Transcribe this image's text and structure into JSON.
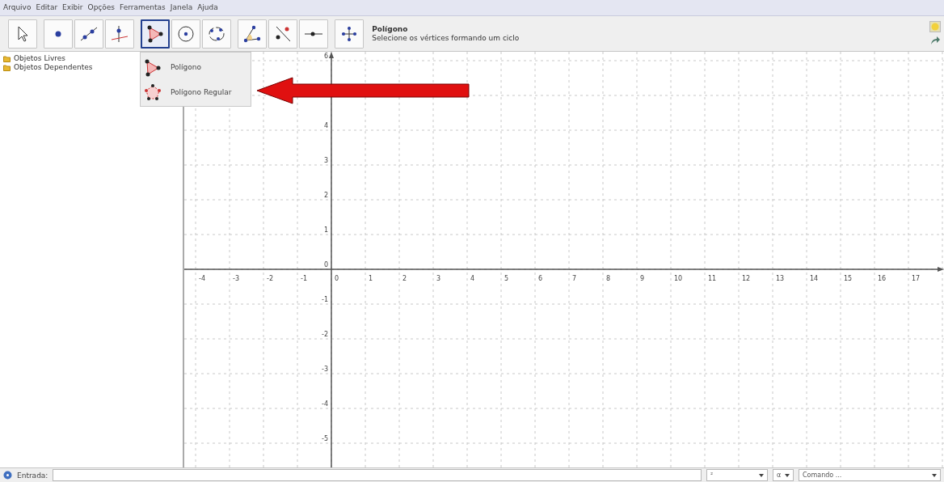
{
  "menu": [
    "Arquivo",
    "Editar",
    "Exibir",
    "Opções",
    "Ferramentas",
    "Janela",
    "Ajuda"
  ],
  "toolbar": {
    "groups": [
      {
        "tools": [
          {
            "selected": false
          }
        ]
      },
      {
        "tools": [
          {
            "selected": false
          },
          {
            "selected": false
          },
          {
            "selected": false
          }
        ]
      },
      {
        "tools": [
          {
            "selected": true
          },
          {
            "selected": false
          },
          {
            "selected": false
          }
        ]
      },
      {
        "tools": [
          {
            "selected": false
          },
          {
            "selected": false
          },
          {
            "selected": false
          }
        ]
      },
      {
        "tools": [
          {
            "selected": false
          }
        ]
      }
    ],
    "tool_title": "Polígono",
    "tool_hint": "Selecione os vértices formando um ciclo"
  },
  "tool_menu": [
    "Polígono",
    "Polígono Regular"
  ],
  "algebra_view": {
    "folders": [
      "Objetos Livres",
      "Objetos Dependentes"
    ]
  },
  "graphics_view": {
    "x_labels": [
      "-4",
      "-3",
      "-2",
      "-1",
      "0",
      "1",
      "2",
      "3",
      "4",
      "5",
      "6",
      "7",
      "8",
      "9",
      "10",
      "11",
      "12",
      "13",
      "14",
      "15",
      "16",
      "17"
    ],
    "y_labels": [
      "6",
      "4",
      "3",
      "2",
      "1",
      "0",
      "-1",
      "-2",
      "-3",
      "-4",
      "-5"
    ]
  },
  "input_bar": {
    "label": "Entrada:",
    "symbols": "²",
    "greek": "α",
    "command": "Comando ..."
  }
}
